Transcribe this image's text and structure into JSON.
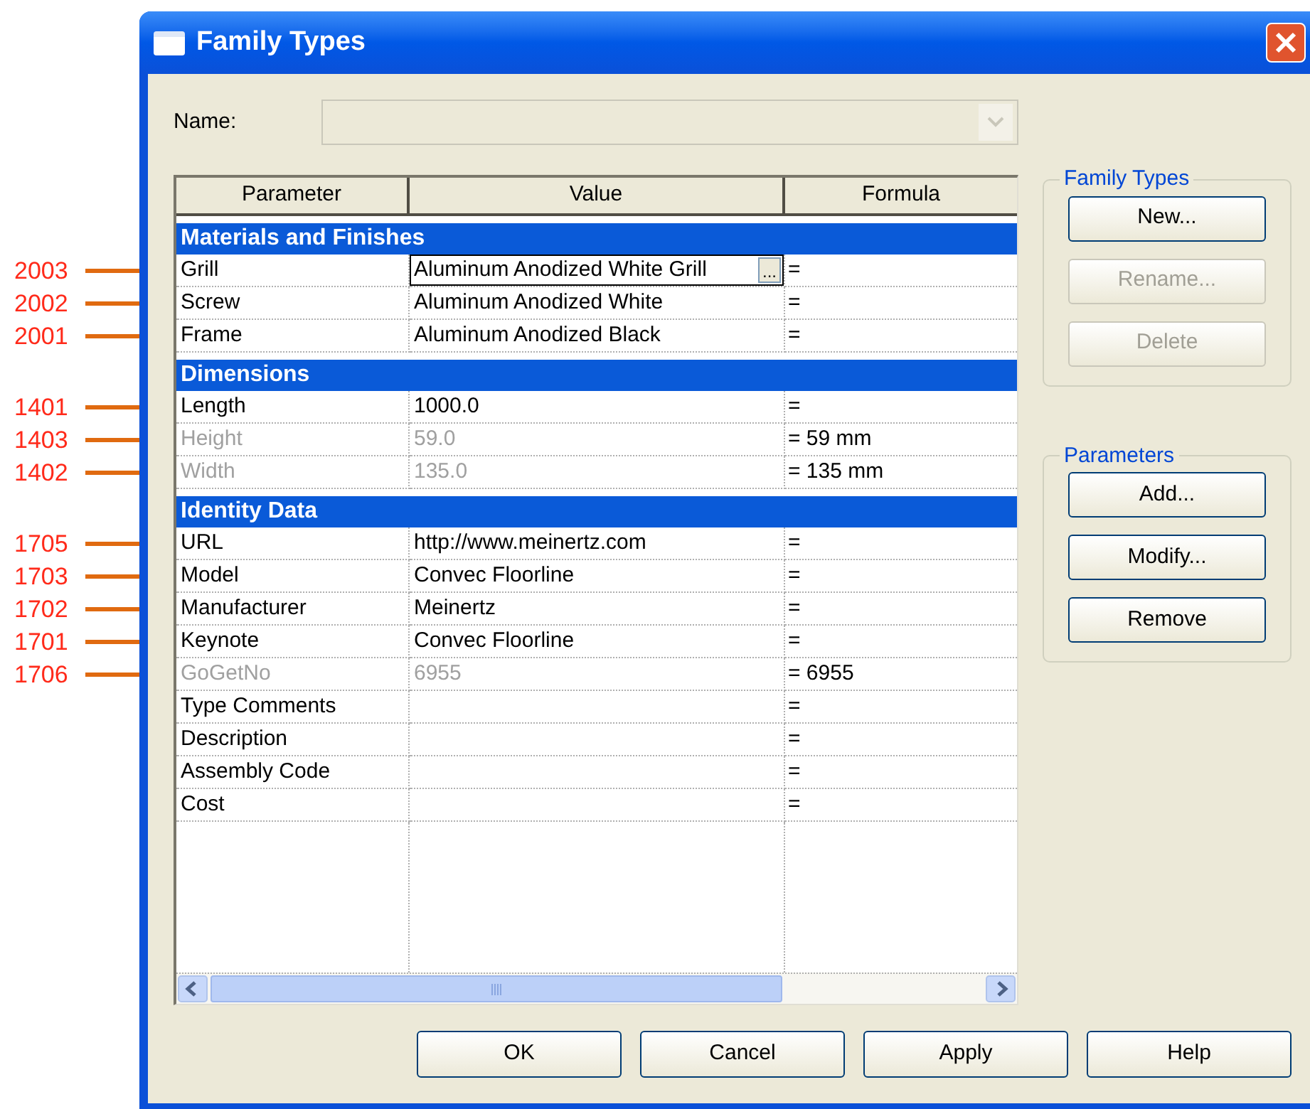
{
  "window": {
    "title": "Family Types"
  },
  "name_field": {
    "label": "Name:",
    "disabled": true
  },
  "table": {
    "columns": [
      "Parameter",
      "Value",
      "Formula"
    ],
    "browse_button": "...",
    "groups": [
      {
        "title": "Materials and Finishes",
        "rows": [
          {
            "parameter": "Grill",
            "value": "Aluminum Anodized White Grill",
            "formula": "=",
            "disabled": false,
            "editing": true,
            "callout": "2003"
          },
          {
            "parameter": "Screw",
            "value": "Aluminum Anodized White",
            "formula": "=",
            "disabled": false,
            "editing": false,
            "callout": "2002"
          },
          {
            "parameter": "Frame",
            "value": "Aluminum Anodized Black",
            "formula": "=",
            "disabled": false,
            "editing": false,
            "callout": "2001"
          }
        ]
      },
      {
        "title": "Dimensions",
        "rows": [
          {
            "parameter": "Length",
            "value": "1000.0",
            "formula": "=",
            "disabled": false,
            "editing": false,
            "callout": "1401"
          },
          {
            "parameter": "Height",
            "value": "59.0",
            "formula": "= 59 mm",
            "disabled": true,
            "editing": false,
            "callout": "1403"
          },
          {
            "parameter": "Width",
            "value": "135.0",
            "formula": "= 135 mm",
            "disabled": true,
            "editing": false,
            "callout": "1402"
          }
        ]
      },
      {
        "title": "Identity Data",
        "rows": [
          {
            "parameter": "URL",
            "value": "http://www.meinertz.com",
            "formula": "=",
            "disabled": false,
            "editing": false,
            "callout": "1705"
          },
          {
            "parameter": "Model",
            "value": "Convec Floorline",
            "formula": "=",
            "disabled": false,
            "editing": false,
            "callout": "1703"
          },
          {
            "parameter": "Manufacturer",
            "value": "Meinertz",
            "formula": "=",
            "disabled": false,
            "editing": false,
            "callout": "1702"
          },
          {
            "parameter": "Keynote",
            "value": "Convec Floorline",
            "formula": "=",
            "disabled": false,
            "editing": false,
            "callout": "1701"
          },
          {
            "parameter": "GoGetNo",
            "value": "6955",
            "formula": "= 6955",
            "disabled": true,
            "editing": false,
            "callout": "1706"
          },
          {
            "parameter": "Type Comments",
            "formula": "=",
            "disabled": false,
            "editing": false
          },
          {
            "parameter": "Description",
            "formula": "=",
            "disabled": false,
            "editing": false
          },
          {
            "parameter": "Assembly Code",
            "formula": "=",
            "disabled": false,
            "editing": false
          },
          {
            "parameter": "Cost",
            "formula": "=",
            "disabled": false,
            "editing": false
          }
        ]
      }
    ]
  },
  "family_types_group": {
    "title": "Family Types",
    "buttons": [
      {
        "label": "New...",
        "disabled": false
      },
      {
        "label": "Rename...",
        "disabled": true
      },
      {
        "label": "Delete",
        "disabled": true
      }
    ]
  },
  "parameters_group": {
    "title": "Parameters",
    "buttons": [
      {
        "label": "Add...",
        "disabled": false
      },
      {
        "label": "Modify...",
        "disabled": false
      },
      {
        "label": "Remove",
        "disabled": false
      }
    ]
  },
  "buttons": [
    "OK",
    "Cancel",
    "Apply",
    "Help"
  ]
}
